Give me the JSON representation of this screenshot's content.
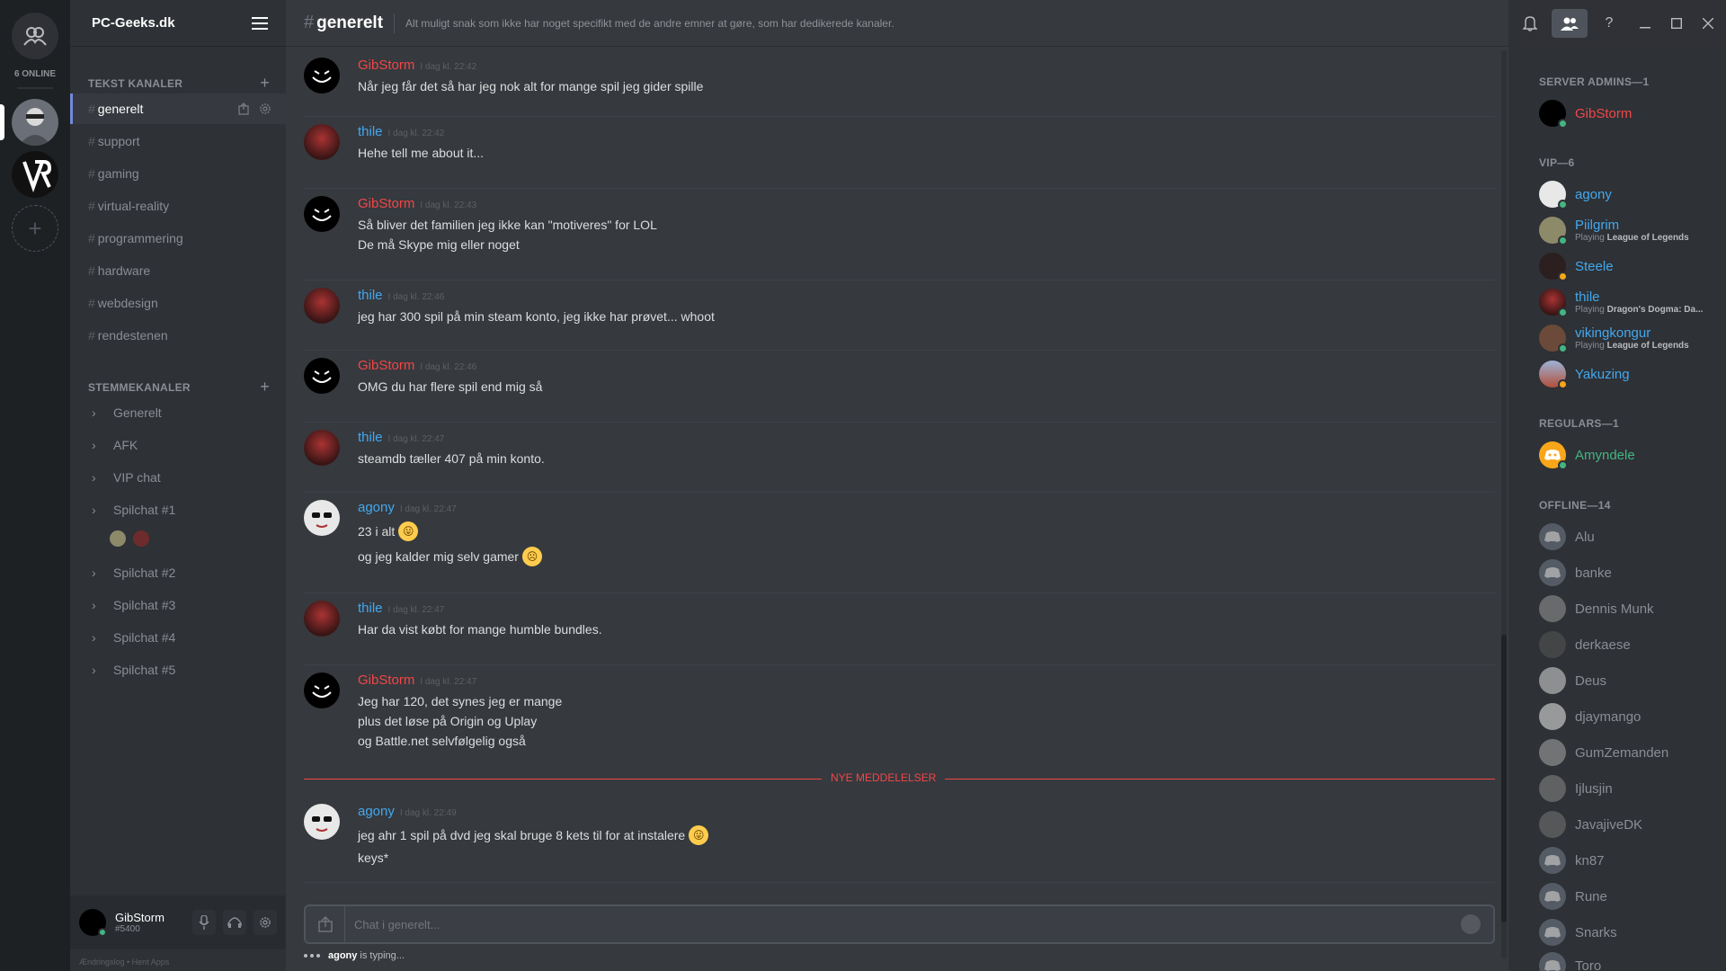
{
  "guilds": {
    "online_count": "6 ONLINE"
  },
  "server": {
    "name": "PC-Geeks.dk"
  },
  "channels": {
    "text_header": "TEKST KANALER",
    "text": [
      {
        "name": "generelt"
      },
      {
        "name": "support"
      },
      {
        "name": "gaming"
      },
      {
        "name": "virtual-reality"
      },
      {
        "name": "programmering"
      },
      {
        "name": "hardware"
      },
      {
        "name": "webdesign"
      },
      {
        "name": "rendestenen"
      }
    ],
    "voice_header": "STEMMEKANALER",
    "voice": [
      {
        "name": "Generelt"
      },
      {
        "name": "AFK"
      },
      {
        "name": "VIP chat"
      },
      {
        "name": "Spilchat #1"
      },
      {
        "name": "Spilchat #2"
      },
      {
        "name": "Spilchat #3"
      },
      {
        "name": "Spilchat #4"
      },
      {
        "name": "Spilchat #5"
      }
    ]
  },
  "user_panel": {
    "name": "GibStorm",
    "tag": "#5400",
    "footer": "Ændringslog • Hent Apps"
  },
  "header": {
    "hash": "#",
    "channel": "generelt",
    "topic": "Alt muligt snak som ikke har noget specifikt med de andre emner at gøre, som har dedikerede kanaler.",
    "help": "?"
  },
  "messages": [
    {
      "author": "GibStorm",
      "ts": "I dag kl. 22:42",
      "lines": [
        "Når jeg får det så har jeg nok alt for mange spil jeg gider spille"
      ]
    },
    {
      "author": "thile",
      "ts": "I dag kl. 22:42",
      "lines": [
        "Hehe tell me about it..."
      ]
    },
    {
      "author": "GibStorm",
      "ts": "I dag kl. 22:43",
      "lines": [
        "Så bliver det familien jeg ikke kan \"motiveres\" for LOL",
        "De må Skype mig eller noget"
      ]
    },
    {
      "author": "thile",
      "ts": "I dag kl. 22:46",
      "lines": [
        "jeg har 300 spil på min steam konto, jeg ikke har prøvet...  whoot"
      ]
    },
    {
      "author": "GibStorm",
      "ts": "I dag kl. 22:46",
      "lines": [
        "OMG du har flere spil end mig så"
      ]
    },
    {
      "author": "thile",
      "ts": "I dag kl. 22:47",
      "lines": [
        "steamdb tæller 407 på min konto."
      ]
    },
    {
      "author": "agony",
      "ts": "I dag kl. 22:47",
      "lines": [
        "23 i alt",
        "og jeg kalder mig selv gamer"
      ]
    },
    {
      "author": "thile",
      "ts": "I dag kl. 22:47",
      "lines": [
        "Har da vist købt for mange humble bundles."
      ]
    },
    {
      "author": "GibStorm",
      "ts": "I dag kl. 22:47",
      "lines": [
        "Jeg har 120, det synes jeg er mange",
        "plus det løse på Origin og Uplay",
        "og Battle.net selvfølgelig også"
      ]
    },
    {
      "author": "agony",
      "ts": "I dag kl. 22:49",
      "lines": [
        "jeg ahr 1 spil på dvd jeg skal bruge 8 kets til for at instalere",
        "keys*"
      ]
    }
  ],
  "emoji": {
    "tongue": "😛",
    "frown": "☹"
  },
  "new_messages_label": "NYE MEDDELELSER",
  "composer": {
    "placeholder": "Chat i generelt..."
  },
  "typing": {
    "user": "agony",
    "text": "is typing..."
  },
  "members": {
    "groups": [
      {
        "label": "SERVER ADMINS—1"
      },
      {
        "label": "VIP—6"
      },
      {
        "label": "REGULARS—1"
      },
      {
        "label": "OFFLINE—14"
      }
    ],
    "admins": [
      {
        "name": "GibStorm"
      }
    ],
    "vip": [
      {
        "name": "agony"
      },
      {
        "name": "Piilgrim",
        "playing": "Playing",
        "game": "League of Legends"
      },
      {
        "name": "Steele"
      },
      {
        "name": "thile",
        "playing": "Playing",
        "game": "Dragon's Dogma: Da..."
      },
      {
        "name": "vikingkongur",
        "playing": "Playing",
        "game": "League of Legends"
      },
      {
        "name": "Yakuzing"
      }
    ],
    "regulars": [
      {
        "name": "Amyndele"
      }
    ],
    "offline": [
      {
        "name": "Alu"
      },
      {
        "name": "banke"
      },
      {
        "name": "Dennis Munk"
      },
      {
        "name": "derkaese"
      },
      {
        "name": "Deus"
      },
      {
        "name": "djaymango"
      },
      {
        "name": "GumZemanden"
      },
      {
        "name": "Ijlusjin"
      },
      {
        "name": "JavajiveDK"
      },
      {
        "name": "kn87"
      },
      {
        "name": "Rune"
      },
      {
        "name": "Snarks"
      },
      {
        "name": "Toro"
      }
    ]
  },
  "colors": {
    "admin": "#f04747",
    "vip": "#43a8ed",
    "regular": "#43b581",
    "online": "#43b581",
    "idle": "#faa61a"
  }
}
